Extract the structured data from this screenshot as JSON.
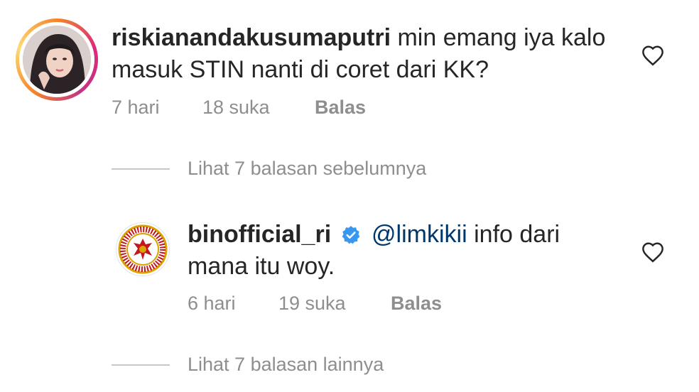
{
  "comments": [
    {
      "username": "riskianandakusumaputri",
      "text": "min emang iya kalo masuk STIN nanti di coret dari KK?",
      "time": "7 hari",
      "likes": "18 suka",
      "reply": "Balas",
      "avatar_icon": "profile-photo",
      "like_icon": "heart-outline-icon"
    },
    {
      "username": "binofficial_ri",
      "verified_icon": "verified-badge-icon",
      "mention": "@limkikii",
      "text_line1": "info dari",
      "text_line2": "mana itu woy.",
      "time": "6 hari",
      "likes": "19 suka",
      "reply": "Balas",
      "avatar_icon": "bin-emblem-logo",
      "like_icon": "heart-outline-icon"
    }
  ],
  "view_previous_replies": "Lihat 7 balasan sebelumnya",
  "view_more_replies": "Lihat 7 balasan lainnya",
  "colors": {
    "text": "#262626",
    "secondary": "#8e8e8e",
    "mention": "#00376b",
    "verified": "#3897f0",
    "bin_red": "#c4161c",
    "bin_gold": "#d9a300"
  }
}
